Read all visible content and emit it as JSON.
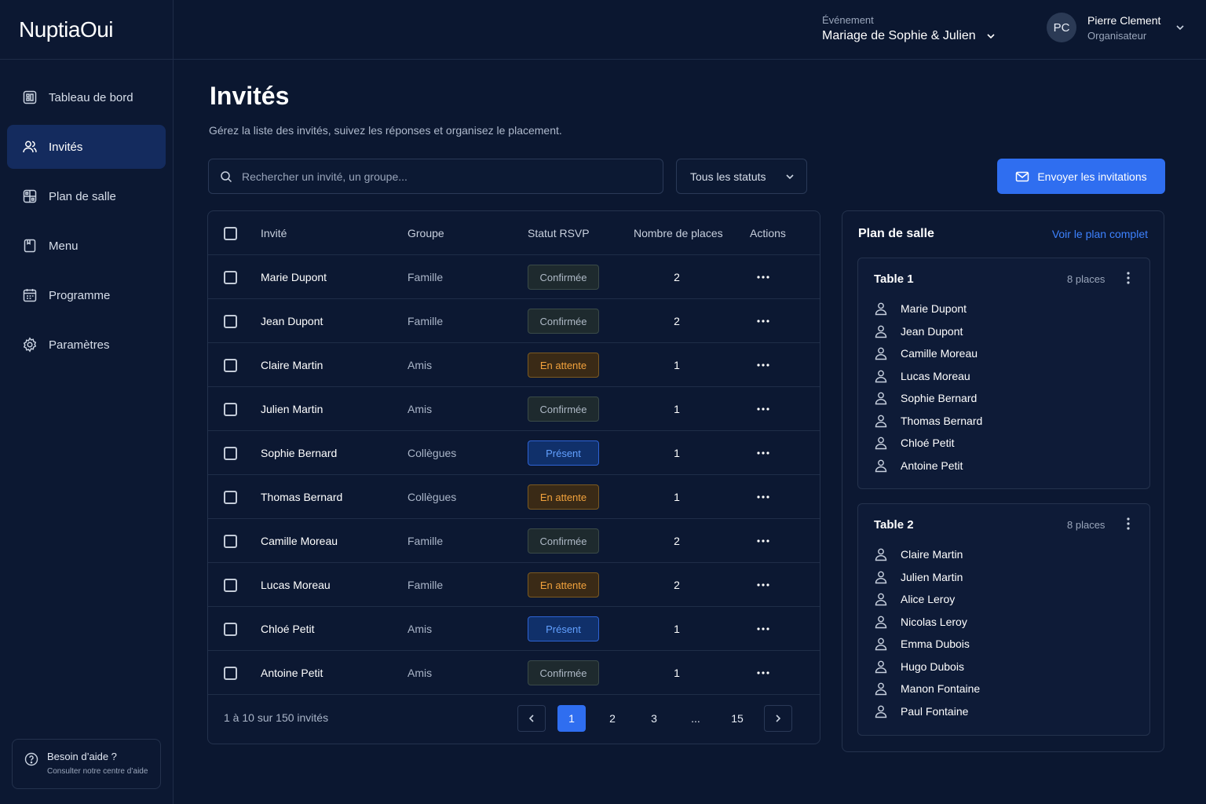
{
  "app": {
    "name": "NuptiaOui"
  },
  "sidebar": {
    "items": [
      {
        "label": "Tableau de bord",
        "icon": "dashboard-icon"
      },
      {
        "label": "Invités",
        "icon": "users-icon",
        "active": true
      },
      {
        "label": "Plan de salle",
        "icon": "layout-icon"
      },
      {
        "label": "Menu",
        "icon": "menu-book-icon"
      },
      {
        "label": "Programme",
        "icon": "calendar-icon"
      },
      {
        "label": "Paramètres",
        "icon": "gear-icon"
      }
    ],
    "help": {
      "title": "Besoin d’aide ?",
      "subtitle": "Consulter notre centre d’aide"
    }
  },
  "topbar": {
    "event_label": "Événement",
    "event_name": "Mariage de Sophie & Julien",
    "user": {
      "initials": "PC",
      "name": "Pierre Clement",
      "role": "Organisateur"
    }
  },
  "main": {
    "title": "Invités",
    "subtitle": "Gérez la liste des invités, suivez les réponses et organisez le placement.",
    "search_placeholder": "Rechercher un invité, un groupe...",
    "status_filter": "Tous les statuts",
    "send_button": "Envoyer les invitations"
  },
  "table": {
    "headers": {
      "guest": "Invité",
      "group": "Groupe",
      "status": "Statut RSVP",
      "places": "Nombre de places",
      "actions": "Actions"
    },
    "rows": [
      {
        "name": "Marie Dupont",
        "group": "Famille",
        "status": "Confirmée",
        "places": "2"
      },
      {
        "name": "Jean Dupont",
        "group": "Famille",
        "status": "Confirmée",
        "places": "2"
      },
      {
        "name": "Claire Martin",
        "group": "Amis",
        "status": "En attente",
        "places": "1"
      },
      {
        "name": "Julien Martin",
        "group": "Amis",
        "status": "Confirmée",
        "places": "1"
      },
      {
        "name": "Sophie Bernard",
        "group": "Collègues",
        "status": "Présent",
        "places": "1"
      },
      {
        "name": "Thomas Bernard",
        "group": "Collègues",
        "status": "En attente",
        "places": "1"
      },
      {
        "name": "Camille Moreau",
        "group": "Famille",
        "status": "Confirmée",
        "places": "2"
      },
      {
        "name": "Lucas Moreau",
        "group": "Famille",
        "status": "En attente",
        "places": "2"
      },
      {
        "name": "Chloé Petit",
        "group": "Amis",
        "status": "Présent",
        "places": "1"
      },
      {
        "name": "Antoine Petit",
        "group": "Amis",
        "status": "Confirmée",
        "places": "1"
      }
    ],
    "footer": {
      "count": "1 à 10 sur 150 invités",
      "pages": [
        "1",
        "2",
        "3",
        "...",
        "15"
      ],
      "current_page": "1"
    }
  },
  "plan": {
    "title": "Plan de salle",
    "link": "Voir le plan complet",
    "tables": [
      {
        "name": "Table 1",
        "places": "8 places",
        "guests": [
          "Marie Dupont",
          "Jean Dupont",
          "Camille Moreau",
          "Lucas Moreau",
          "Sophie Bernard",
          "Thomas Bernard",
          "Chloé Petit",
          "Antoine Petit"
        ]
      },
      {
        "name": "Table 2",
        "places": "8 places",
        "guests": [
          "Claire Martin",
          "Julien Martin",
          "Alice Leroy",
          "Nicolas Leroy",
          "Emma Dubois",
          "Hugo Dubois",
          "Manon Fontaine",
          "Paul Fontaine"
        ]
      }
    ]
  },
  "colors": {
    "accent": "#2f6ef0",
    "background": "#0b1730",
    "pending": "#f2a23c",
    "present": "#62a0ff"
  }
}
